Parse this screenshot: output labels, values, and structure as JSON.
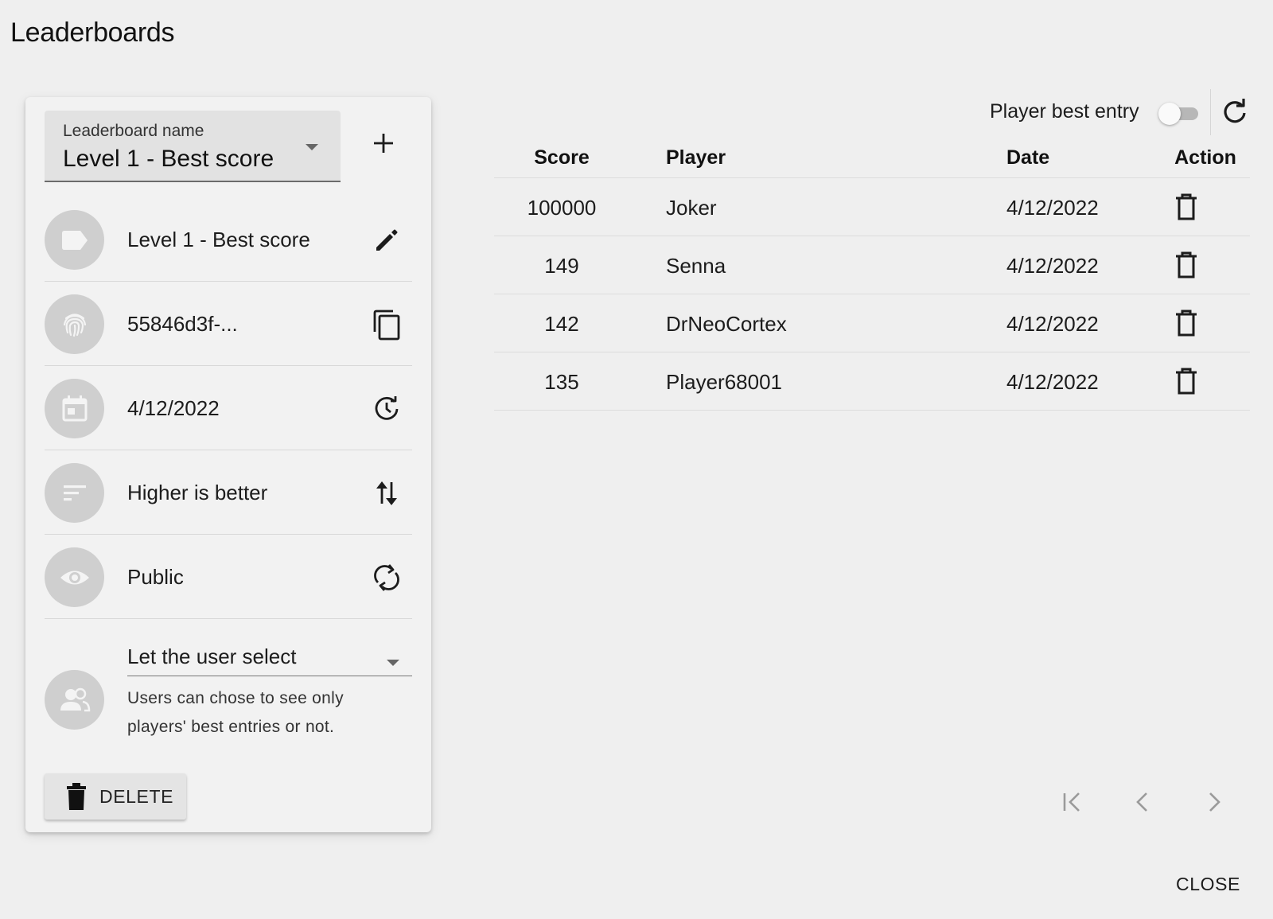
{
  "page": {
    "title": "Leaderboards"
  },
  "sidebar": {
    "select": {
      "label": "Leaderboard name",
      "value": "Level 1 - Best score"
    },
    "add_icon": "plus-icon",
    "rows": [
      {
        "avatar_icon": "label-icon",
        "text": "Level 1 - Best score",
        "action_icon": "pencil-icon"
      },
      {
        "avatar_icon": "fingerprint-icon",
        "text": "55846d3f-...",
        "action_icon": "copy-icon"
      },
      {
        "avatar_icon": "calendar-icon",
        "text": "4/12/2022",
        "action_icon": "restore-clock-icon"
      },
      {
        "avatar_icon": "sort-icon",
        "text": "Higher is better",
        "action_icon": "swap-vertical-icon"
      },
      {
        "avatar_icon": "eye-icon",
        "text": "Public",
        "action_icon": "sync-icon"
      }
    ],
    "visibility": {
      "avatar_icon": "people-icon",
      "select_value": "Let the user select",
      "helper_text": "Users can chose to see only players' best entries or not."
    },
    "delete_button": {
      "label": "DELETE",
      "icon": "trash-icon"
    }
  },
  "toolbar": {
    "player_best_entry_label": "Player best entry",
    "player_best_entry_enabled": false,
    "refresh_icon": "refresh-icon"
  },
  "table": {
    "headers": {
      "score": "Score",
      "player": "Player",
      "date": "Date",
      "action": "Action"
    },
    "rows": [
      {
        "score": "100000",
        "player": "Joker",
        "date": "4/12/2022"
      },
      {
        "score": "149",
        "player": "Senna",
        "date": "4/12/2022"
      },
      {
        "score": "142",
        "player": "DrNeoCortex",
        "date": "4/12/2022"
      },
      {
        "score": "135",
        "player": "Player68001",
        "date": "4/12/2022"
      }
    ]
  },
  "pagination": {
    "first_icon": "first-page-icon",
    "prev_icon": "chevron-left-icon",
    "next_icon": "chevron-right-icon"
  },
  "footer": {
    "close_label": "CLOSE"
  },
  "colors": {
    "avatar_bg": "#cfcfcf",
    "avatar_icon": "#f4f4f4",
    "background": "#efefef",
    "pager_disabled": "#9a9a9a"
  }
}
